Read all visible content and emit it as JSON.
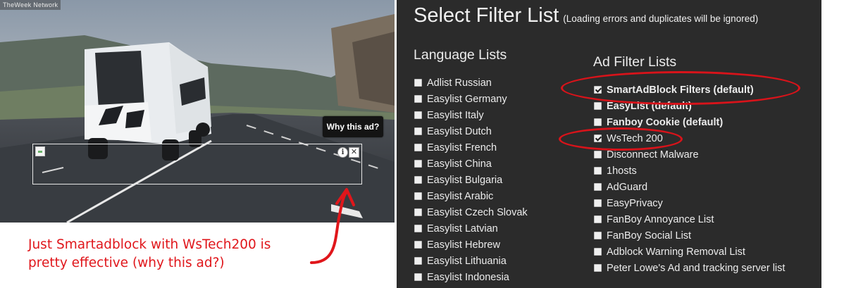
{
  "video": {
    "network_logo": "TheWeek Network",
    "why_this_ad": "Why this ad?",
    "ad_info_icon": "info-icon",
    "ad_close_icon": "close-icon",
    "ad_close_glyph": "✕",
    "ad_info_glyph": "i"
  },
  "annotation": {
    "line1": "Just Smartadblock with WsTech200 is",
    "line2": "pretty effective (why this ad?)",
    "color": "#e0161b"
  },
  "filter_panel": {
    "title": "Select Filter List",
    "subtitle": "(Loading errors and duplicates will be ignored)",
    "language_heading": "Language Lists",
    "ad_heading": "Ad Filter Lists",
    "language_lists": [
      {
        "label": "Adlist Russian",
        "checked": false
      },
      {
        "label": "Easylist Germany",
        "checked": false
      },
      {
        "label": "Easylist Italy",
        "checked": false
      },
      {
        "label": "Easylist Dutch",
        "checked": false
      },
      {
        "label": "Easylist French",
        "checked": false
      },
      {
        "label": "Easylist China",
        "checked": false
      },
      {
        "label": "Easylist Bulgaria",
        "checked": false
      },
      {
        "label": "Easylist Arabic",
        "checked": false
      },
      {
        "label": "Easylist Czech Slovak",
        "checked": false
      },
      {
        "label": "Easylist Latvian",
        "checked": false
      },
      {
        "label": "Easylist Hebrew",
        "checked": false
      },
      {
        "label": "Easylist Lithuania",
        "checked": false
      },
      {
        "label": "Easylist Indonesia",
        "checked": false
      }
    ],
    "ad_lists": [
      {
        "label": "SmartAdBlock Filters (default)",
        "checked": true,
        "bold": true
      },
      {
        "label": "EasyList (default)",
        "checked": false,
        "bold": true
      },
      {
        "label": "Fanboy Cookie (default)",
        "checked": false,
        "bold": true
      },
      {
        "label": "WsTech 200",
        "checked": true,
        "bold": false
      },
      {
        "label": "Disconnect Malware",
        "checked": false,
        "bold": false
      },
      {
        "label": "1hosts",
        "checked": false,
        "bold": false
      },
      {
        "label": "AdGuard",
        "checked": false,
        "bold": false
      },
      {
        "label": "EasyPrivacy",
        "checked": false,
        "bold": false
      },
      {
        "label": "FanBoy Annoyance List",
        "checked": false,
        "bold": false
      },
      {
        "label": "FanBoy Social List",
        "checked": false,
        "bold": false
      },
      {
        "label": "Adblock Warning Removal List",
        "checked": false,
        "bold": false
      },
      {
        "label": "Peter Lowe's Ad and tracking server list",
        "checked": false,
        "bold": false
      }
    ],
    "highlight_color": "#d8131a",
    "background_color": "#2b2b2b"
  }
}
